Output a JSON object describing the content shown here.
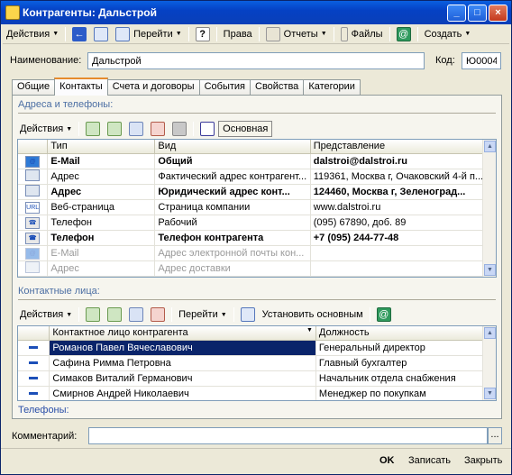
{
  "window": {
    "title": "Контрагенты: Дальстрой"
  },
  "toolbar": {
    "actions": "Действия",
    "goto": "Перейти",
    "help": "?",
    "rights": "Права",
    "reports": "Отчеты",
    "files": "Файлы",
    "create": "Создать"
  },
  "form": {
    "name_label": "Наименование:",
    "name_value": "Дальстрой",
    "code_label": "Код:",
    "code_value": "Ю0004"
  },
  "tabs": [
    "Общие",
    "Контакты",
    "Счета и договоры",
    "События",
    "Свойства",
    "Категории"
  ],
  "addresses": {
    "title": "Адреса и телефоны:",
    "actions": "Действия",
    "main_button": "Основная",
    "columns": [
      "Тип",
      "Вид",
      "Представление"
    ],
    "rows": [
      {
        "icon": "email",
        "type": "E-Mail",
        "kind": "Общий",
        "value": "dalstroi@dalstroi.ru",
        "style": "bold"
      },
      {
        "icon": "address",
        "type": "Адрес",
        "kind": "Фактический адрес контрагент...",
        "value": "119361, Москва г, Очаковский 4-й п...",
        "style": ""
      },
      {
        "icon": "address",
        "type": "Адрес",
        "kind": "Юридический адрес конт...",
        "value": "124460, Москва г, Зеленоград...",
        "style": "bold"
      },
      {
        "icon": "url",
        "type": "Веб-страница",
        "kind": "Страница компании",
        "value": "www.dalstroi.ru",
        "style": ""
      },
      {
        "icon": "phone",
        "type": "Телефон",
        "kind": "Рабочий",
        "value": "(095) 67890, доб. 89",
        "style": ""
      },
      {
        "icon": "phone",
        "type": "Телефон",
        "kind": "Телефон контрагента",
        "value": "+7 (095) 244-77-48",
        "style": "bold"
      },
      {
        "icon": "email",
        "type": "E-Mail",
        "kind": "Адрес электронной почты кон...",
        "value": "",
        "style": "gray"
      },
      {
        "icon": "address",
        "type": "Адрес",
        "kind": "Адрес доставки",
        "value": "",
        "style": "gray"
      }
    ]
  },
  "contacts": {
    "title": "Контактные лица:",
    "actions": "Действия",
    "goto": "Перейти",
    "set_main": "Установить основным",
    "columns": [
      "Контактное лицо контрагента",
      "Должность"
    ],
    "rows": [
      {
        "name": "Романов Павел Вячеславович",
        "position": "Генеральный директор",
        "selected": true
      },
      {
        "name": "Сафина Римма Петровна",
        "position": "Главный бухгалтер",
        "selected": false
      },
      {
        "name": "Симаков Виталий Германович",
        "position": "Начальник отдела снабжения",
        "selected": false
      },
      {
        "name": "Смирнов Андрей Николаевич",
        "position": "Менеджер по покупкам",
        "selected": false
      }
    ],
    "phones_label": "Телефоны:"
  },
  "comment": {
    "label": "Комментарий:",
    "value": "",
    "button": "..."
  },
  "footer": {
    "ok": "OK",
    "save": "Записать",
    "close": "Закрыть"
  },
  "colors": {
    "title_bar": "#0541c4",
    "selection": "#0a246a",
    "section_title": "#4b6ea3"
  }
}
